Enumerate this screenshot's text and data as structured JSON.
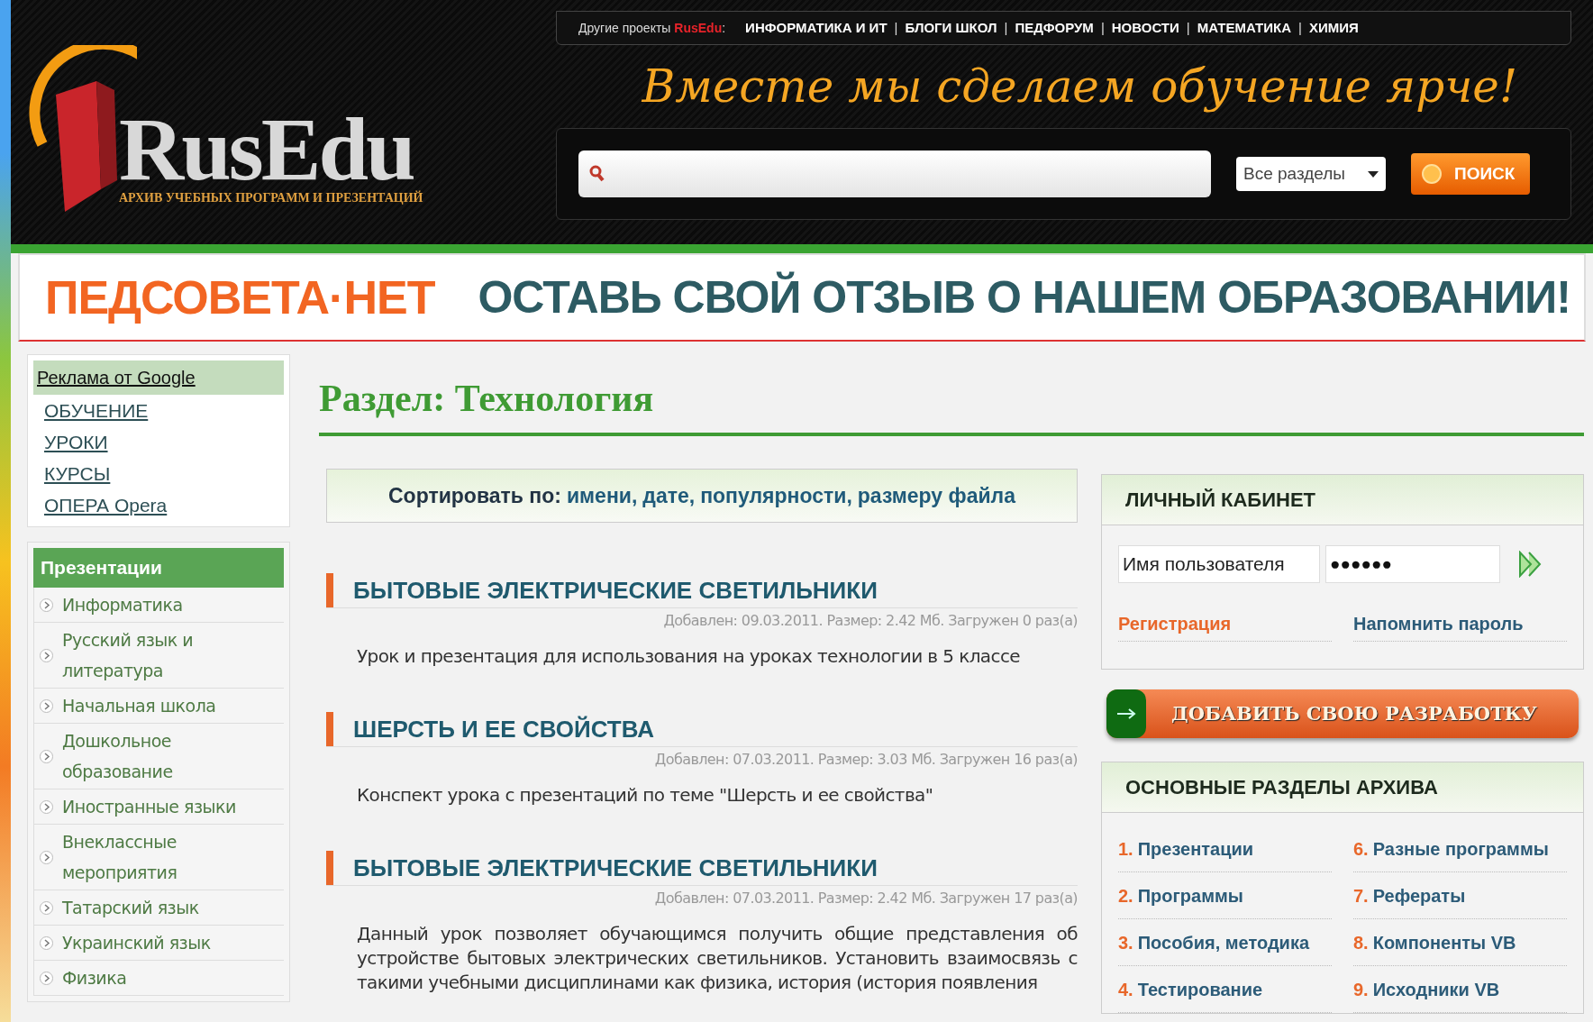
{
  "header": {
    "logo": {
      "name": "RusEdu",
      "subtitle": "АРХИВ УЧЕБНЫХ ПРОГРАММ И ПРЕЗЕНТАЦИЙ"
    },
    "top_nav": {
      "label": "Другие проекты",
      "brand": "RusEdu",
      "suffix": ":",
      "separator": "|",
      "links": [
        "ИНФОРМАТИКА И ИТ",
        "БЛОГИ ШКОЛ",
        "ПЕДФОРУМ",
        "НОВОСТИ",
        "МАТЕМАТИКА",
        "ХИМИЯ"
      ]
    },
    "slogan": "Вместе мы сделаем обучение ярче!",
    "search": {
      "section_select": "Все разделы",
      "button": "ПОИСК"
    }
  },
  "banner": {
    "brand": "ПЕДСОВЕТА·НЕТ",
    "message": "ОСТАВЬ СВОЙ ОТЗЫВ О НАШЕМ ОБРАЗОВАНИИ!"
  },
  "sidebar": {
    "ads": {
      "title": "Реклама от Google",
      "links": [
        "ОБУЧЕНИЕ",
        "УРОКИ",
        "КУРСЫ",
        "ОПЕРА Opera"
      ]
    },
    "categories": {
      "title": "Презентации",
      "items": [
        "Информатика",
        "Русский язык и литература",
        "Начальная школа",
        "Дошкольное образование",
        "Иностранные языки",
        "Внеклассные мероприятия",
        "Татарский язык",
        "Украинский язык",
        "Физика"
      ]
    }
  },
  "main": {
    "title": "Раздел: Технология",
    "sort": {
      "label": "Сортировать по:",
      "options": [
        "имени,",
        "дате,",
        "популярности,",
        "размеру файла"
      ]
    },
    "items": [
      {
        "title": "БЫТОВЫЕ ЭЛЕКТРИЧЕСКИЕ СВЕТИЛЬНИКИ",
        "meta": "Добавлен: 09.03.2011. Размер: 2.42 Мб. Загружен 0 раз(а)",
        "description": "Урок и презентация для использования на уроках технологии в 5 классе"
      },
      {
        "title": "ШЕРСТЬ И ЕЕ СВОЙСТВА",
        "meta": "Добавлен: 07.03.2011. Размер: 3.03 Мб. Загружен 16 раз(а)",
        "description": "Конспект урока с презентаций по теме \"Шерсть и ее свойства\""
      },
      {
        "title": "БЫТОВЫЕ ЭЛЕКТРИЧЕСКИЕ СВЕТИЛЬНИКИ",
        "meta": "Добавлен: 07.03.2011. Размер: 2.42 Мб. Загружен 17 раз(а)",
        "description": "Данный урок позволяет обучающимся получить общие представления об устройстве бытовых электрических светильников. Установить взаимосвязь с такими учебными дисциплинами как физика, история (история появления"
      }
    ]
  },
  "account": {
    "title": "ЛИЧНЫЙ КАБИНЕТ",
    "username": "Имя пользователя",
    "password": "●●●●●●",
    "register": "Регистрация",
    "remind": "Напомнить пароль"
  },
  "add_button": "ДОБАВИТЬ СВОЮ РАЗРАБОТКУ",
  "archive": {
    "title": "ОСНОВНЫЕ РАЗДЕЛЫ АРХИВА",
    "column_1": [
      {
        "number": "1.",
        "label": "Презентации"
      },
      {
        "number": "2.",
        "label": "Программы"
      },
      {
        "number": "3.",
        "label": "Пособия, методика"
      },
      {
        "number": "4.",
        "label": "Тестирование"
      }
    ],
    "column_2": [
      {
        "number": "6.",
        "label": "Разные программы"
      },
      {
        "number": "7.",
        "label": "Рефераты"
      },
      {
        "number": "8.",
        "label": "Компоненты VB"
      },
      {
        "number": "9.",
        "label": "Исходники VB"
      }
    ]
  }
}
